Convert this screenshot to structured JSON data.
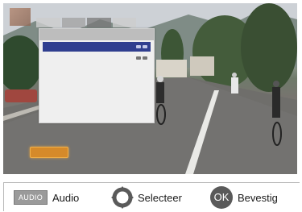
{
  "legend": {
    "audio_key": "AUDIO",
    "audio_label": "Audio",
    "navigate_label": "Selecteer",
    "ok_key": "OK",
    "confirm_label": "Bevestig"
  },
  "icons": {
    "navigate": "directional-pad-icon",
    "confirm": "ok-button-icon"
  },
  "colors": {
    "selected_row": "#2f3e8f",
    "subtitle_tag": "#d58a2a",
    "key_background": "#9a9a9a"
  }
}
